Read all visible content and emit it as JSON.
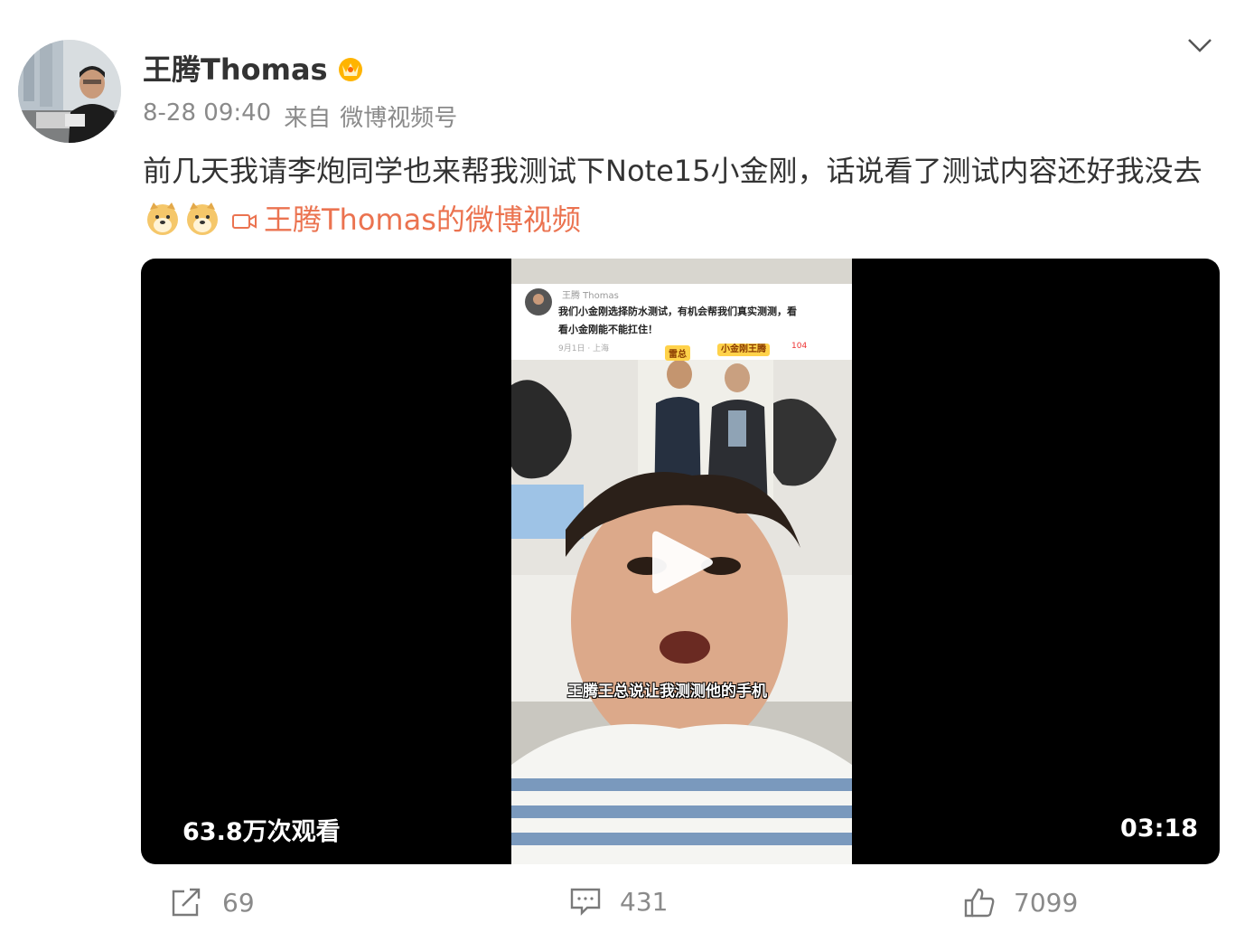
{
  "post": {
    "author": "王腾Thomas",
    "time": "8-28 09:40",
    "source_prefix": "来自",
    "source": "微博视频号",
    "text": "前几天我请李炮同学也来帮我测试下Note15小金刚，话说看了测试内容还好我没去",
    "video_link": "王腾Thomas的微博视频"
  },
  "video": {
    "views": "63.8万次观看",
    "duration": "03:18",
    "frame": {
      "inner_name": "王腾 Thomas",
      "inner_text_1": "我们小金刚选择防水测试，有机会帮我们真实测测，看",
      "inner_text_2": "看小金刚能不能扛住！",
      "inner_meta": "9月1日 · 上海",
      "inner_likes": "104",
      "tag_1": "雷总",
      "tag_2": "小金刚王腾",
      "subtitle": "王腾王总说让我测测他的手机"
    }
  },
  "actions": {
    "repost_count": "69",
    "comment_count": "431",
    "like_count": "7099"
  },
  "icons": {
    "verified": "crown-badge-icon",
    "more": "chevron-down-icon",
    "emoji": "doge-emoji-icon",
    "video_link": "video-camera-icon",
    "repost": "share-icon",
    "comment": "comment-icon",
    "like": "thumbs-up-icon"
  },
  "colors": {
    "link": "#eb7350",
    "meta": "#8a8a8a",
    "text": "#333333",
    "video_bg": "#000000"
  }
}
